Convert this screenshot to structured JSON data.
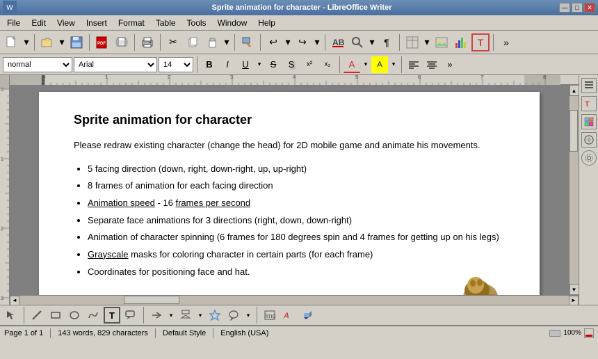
{
  "titlebar": {
    "title": "Sprite animation for character - LibreOffice Writer",
    "close": "✕",
    "maximize": "□",
    "minimize": "—"
  },
  "menubar": {
    "items": [
      "File",
      "Edit",
      "View",
      "Insert",
      "Format",
      "Table",
      "Tools",
      "Window",
      "Help"
    ]
  },
  "toolbar1": {
    "buttons": [
      "📄",
      "💾",
      "🖨",
      "📋",
      "↩",
      "↪",
      "🔤",
      "🔍",
      "¶"
    ],
    "groups": [
      "new",
      "save",
      "print",
      "paste",
      "undo",
      "redo",
      "spellcheck",
      "find",
      "para"
    ]
  },
  "toolbar2": {
    "paragraph_style": "normal",
    "font_name": "Arial",
    "font_size": "14",
    "format_buttons": [
      "A",
      "a",
      "A",
      "A",
      "ab",
      "ab",
      "a",
      "A",
      "≡",
      "≡",
      "»"
    ]
  },
  "document": {
    "title": "Sprite animation for character",
    "body": "Please redraw existing character (change the head) for 2D mobile game and animate his movements.",
    "bullet_items": [
      "5 facing direction (down, right, down-right, up, up-right)",
      "8 frames of animation for each facing direction",
      "Animation speed - 16 frames per second",
      "Separate face animations for 3 directions (right, down, down-right)",
      "Animation of character spinning (6 frames for 180 degrees spin and 4 frames for getting up on his legs)",
      "Grayscale masks for coloring character in certain parts (for each frame)",
      "Coordinates for positioning face and hat."
    ]
  },
  "statusbar": {
    "page_info": "Page 1 of 1",
    "word_count": "143 words, 829 characters",
    "style": "Default Style",
    "language": "English (USA)"
  }
}
